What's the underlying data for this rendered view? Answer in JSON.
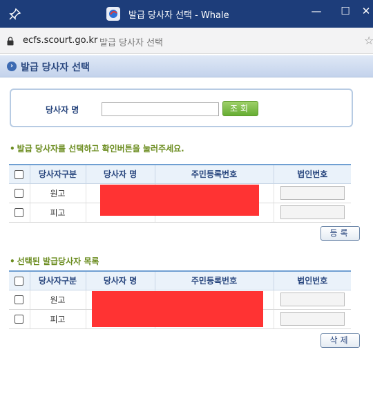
{
  "window": {
    "title": "발급 당사자 선택 - Whale",
    "minimize_label": "—",
    "maximize_label": "☐",
    "close_label": "✕"
  },
  "address": {
    "domain": "ecfs.scourt.go.kr",
    "page_title": "발급 당사자 선택"
  },
  "header": {
    "title": "발급 당사자 선택"
  },
  "search": {
    "label": "당사자 명",
    "value": "",
    "button_label": "조회"
  },
  "section1": {
    "title": "발급 당사자를 선택하고 확인버튼을 눌러주세요.",
    "columns": [
      "당사자구분",
      "당사자 명",
      "주민등록번호",
      "법인번호"
    ],
    "rows": [
      {
        "type": "원고",
        "name": "",
        "rrn": "",
        "corp_no": ""
      },
      {
        "type": "피고",
        "name": "",
        "rrn": "",
        "corp_no": ""
      }
    ],
    "register_button": "등록"
  },
  "section2": {
    "title": "선택된 발급당사자 목록",
    "columns": [
      "당사자구분",
      "당사자 명",
      "주민등록번호",
      "법인번호"
    ],
    "rows": [
      {
        "type": "원고",
        "name": "",
        "rrn": "",
        "corp_no": ""
      },
      {
        "type": "피고",
        "name": "",
        "rrn": "",
        "corp_no": ""
      }
    ],
    "delete_button": "삭제"
  },
  "colors": {
    "titlebar": "#1d3d7a",
    "header_text": "#27457d",
    "section_title": "#6b8c1f",
    "redaction": "#ff3333"
  }
}
